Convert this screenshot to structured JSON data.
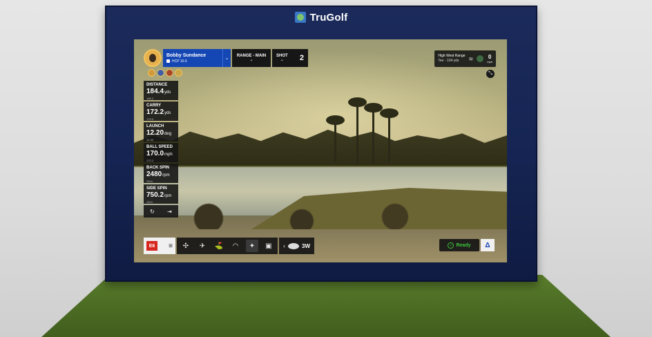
{
  "brand": {
    "name": "TruGolf"
  },
  "player": {
    "name": "Bobby Sundance",
    "hcp": "HCP 10.0",
    "dropdown_icon": "chevron-down-icon"
  },
  "range_select": {
    "label": "RANGE - MAIN",
    "chevron": "⌄"
  },
  "shot": {
    "label": "SHOT",
    "chevron": "⌄",
    "number": "2"
  },
  "stats": [
    {
      "name": "DISTANCE",
      "value": "184.4",
      "unit": "yds",
      "sub": "186.3"
    },
    {
      "name": "CARRY",
      "value": "172.2",
      "unit": "yds",
      "sub": "175.5"
    },
    {
      "name": "LAUNCH",
      "value": "12.20",
      "unit": "deg",
      "sub": "12.30"
    },
    {
      "name": "BALL SPEED",
      "value": "170.0",
      "unit": "mph",
      "sub": "172.2"
    },
    {
      "name": "BACK SPIN",
      "value": "2480",
      "unit": "rpm",
      "sub": "2504"
    },
    {
      "name": "SIDE SPIN",
      "value": "750.2",
      "unit": "rpm",
      "sub": "2504"
    }
  ],
  "stats_footer": {
    "refresh": "↻",
    "export": "⇥"
  },
  "range_info": {
    "line1": "High West Range",
    "line2": "Tee - 104 yds",
    "wind_icon": "≋",
    "wind_value": "0",
    "wind_unit": "mph"
  },
  "collapse_icon": "⤡",
  "toolbar": {
    "logo": "E6",
    "menu": "≡",
    "tools": [
      "✣",
      "✈",
      "⛳",
      "◠",
      "✦",
      "▣"
    ],
    "chevron_left": "‹",
    "club": "3W"
  },
  "status": {
    "check": "✓",
    "text": "Ready"
  },
  "delta": "Δ"
}
